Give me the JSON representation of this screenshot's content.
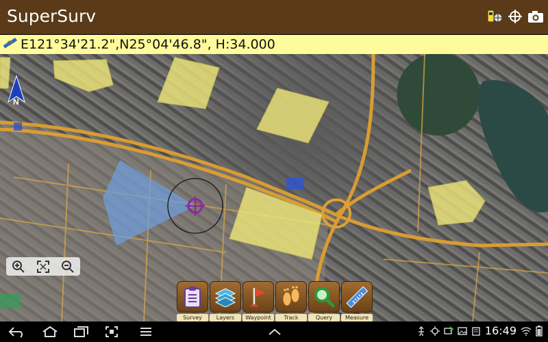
{
  "app": {
    "title": "SuperSurv"
  },
  "coord": {
    "text": "E121°34'21.2\",N25°04'46.8\", H:34.000"
  },
  "map": {
    "north_label": "N"
  },
  "toolbar": {
    "items": [
      {
        "label": "Survey",
        "icon": "clipboard-icon"
      },
      {
        "label": "Layers",
        "icon": "layers-icon"
      },
      {
        "label": "Waypoint",
        "icon": "flag-icon"
      },
      {
        "label": "Track",
        "icon": "footprints-icon"
      },
      {
        "label": "Query",
        "icon": "magnifier-icon"
      },
      {
        "label": "Measure",
        "icon": "ruler-icon"
      }
    ]
  },
  "status": {
    "time": "16:49"
  },
  "colors": {
    "appbar": "#5a3a18",
    "coordbar": "#fffb9b",
    "polygon_fill": "#f0e87a",
    "road": "#e0a030",
    "cursor": "#8a2a9a"
  }
}
